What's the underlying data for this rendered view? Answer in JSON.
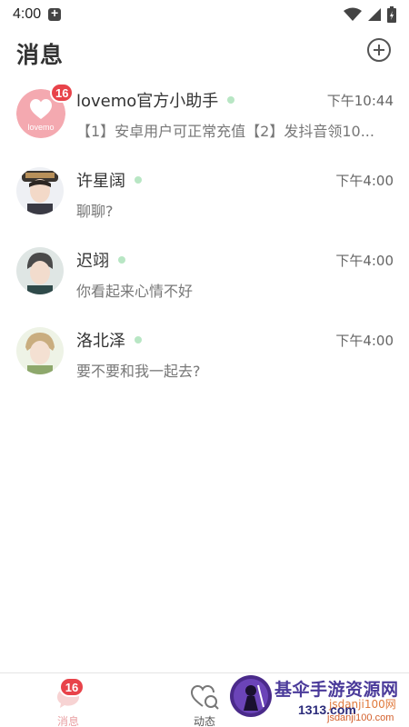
{
  "status_bar": {
    "time": "4:00"
  },
  "header": {
    "title": "消息"
  },
  "conversations": [
    {
      "name": "lovemo官方小助手",
      "time": "下午10:44",
      "preview": "【1】安卓用户可正常充值【2】发抖音领10...",
      "unread": "16",
      "avatar_label": "lovemo"
    },
    {
      "name": "许星阔",
      "time": "下午4:00",
      "preview": "聊聊?"
    },
    {
      "name": "迟翊",
      "time": "下午4:00",
      "preview": "你看起来心情不好"
    },
    {
      "name": "洛北泽",
      "time": "下午4:00",
      "preview": "要不要和我一起去?"
    }
  ],
  "bottom_nav": {
    "messages_label": "消息",
    "messages_badge": "16",
    "moments_label": "动态"
  },
  "watermark": {
    "title": "基伞手游资源网",
    "sub": "jsdanji100网",
    "domain": "1313.com",
    "url": "jsdanji100.com"
  },
  "colors": {
    "badge": "#e8434a",
    "online_dot": "#b8e6c4",
    "active_nav": "#e9a0a3",
    "logo_pink": "#f4a9b0"
  },
  "icons": {
    "add": "plus-circle-icon",
    "wifi": "wifi-icon",
    "signal": "signal-icon",
    "battery": "battery-charging-icon",
    "notification": "notification-icon",
    "messages_nav": "chat-bubble-icon",
    "moments_nav": "heart-search-icon"
  }
}
